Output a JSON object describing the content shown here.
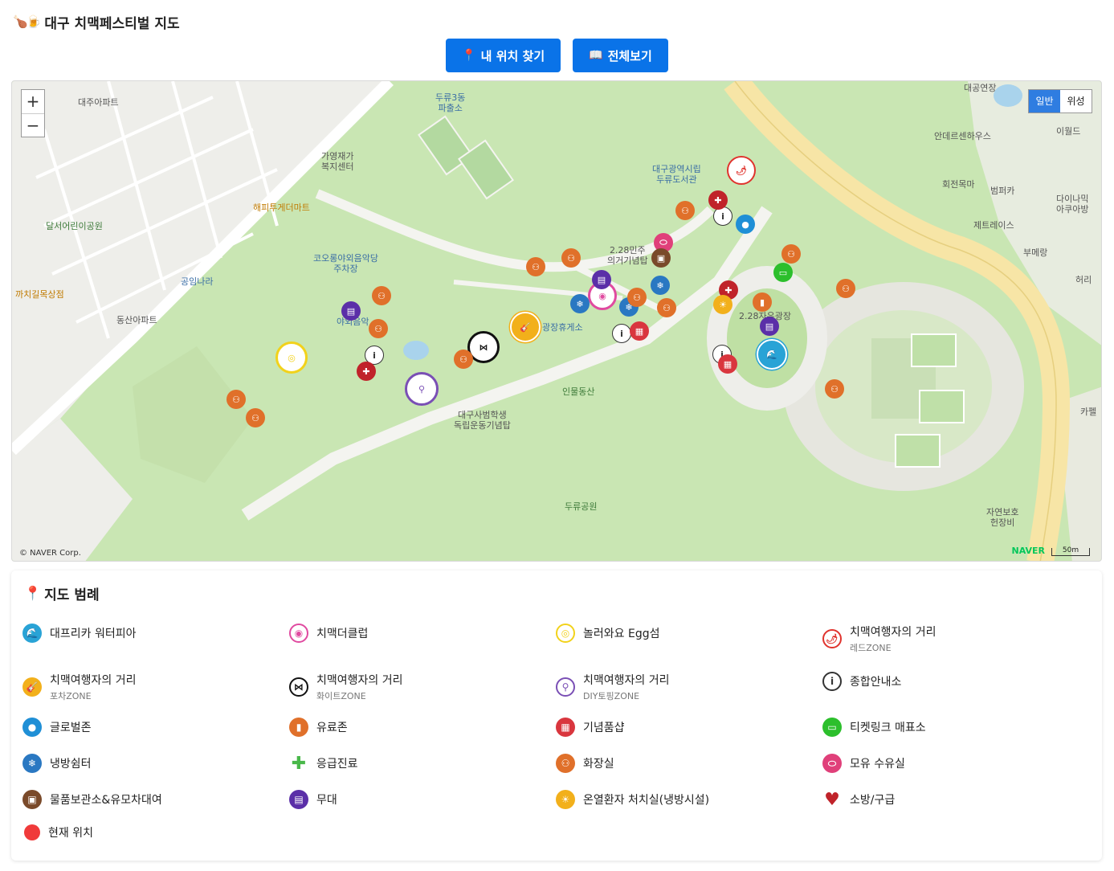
{
  "header": {
    "logo": "🍗🍺",
    "title": "대구 치맥페스티벌 지도"
  },
  "buttons": {
    "locate": {
      "icon": "📍",
      "label": "내 위치 찾기"
    },
    "overview": {
      "icon": "📖",
      "label": "전체보기"
    }
  },
  "map": {
    "zoom_in": "+",
    "zoom_out": "−",
    "map_types": [
      "일반",
      "위성"
    ],
    "selected_map_type": "일반",
    "copyright": "© NAVER Corp.",
    "brand": "NAVER",
    "scale": "50m",
    "place_labels": {
      "daeju_apt": "대주아파트",
      "duryu3dong": "두류3동\n파출소",
      "daegong": "대공연장",
      "iworld": "이월드",
      "andersen": "안데르센하우스",
      "hoejeon": "회전목마",
      "bumper": "범퍼카",
      "daina": "다이나믹\n아쿠아방",
      "jet": "제트레이스",
      "boomerang": "부메랑",
      "heuri": "허리",
      "gayeong": "가영재가\n복지센터",
      "daegu_lib": "대구광역시립\n두류도서관",
      "happy_mart": "해피투게더마트",
      "dalseo_park": "달서어린이공원",
      "korong": "코오롱야외음악당\n주차장",
      "gongim": "공임나라",
      "ggachi": "까치길목상점",
      "dongsan": "동산아파트",
      "dong228": "2.28민주\n의거기념탑",
      "square": "2.28자유광장",
      "rest": "광장휴게소",
      "inmul": "인물동산",
      "teachers": "대구사범학생\n독립운동기념탑",
      "duryu_park": "두류공원",
      "nature": "자연보호\n헌장비",
      "cafe": "카펠",
      "outdoor": "야외음악"
    }
  },
  "legend": {
    "icon": "📍",
    "title": "지도 범례",
    "items": [
      {
        "name": "대프리카 워터피아",
        "sub": "",
        "color": "#29a3d6",
        "icon": "water"
      },
      {
        "name": "치맥더클럽",
        "sub": "",
        "color": "#e04aa0",
        "icon": "club"
      },
      {
        "name": "놀러와요 Egg섬",
        "sub": "",
        "color": "#f2d21b",
        "icon": "egg"
      },
      {
        "name": "치맥여행자의 거리",
        "sub": "레드ZONE",
        "color": "#e0332d",
        "icon": "chili"
      },
      {
        "name": "치맥여행자의 거리",
        "sub": "포차ZONE",
        "color": "#f2b01b",
        "icon": "guitar"
      },
      {
        "name": "치맥여행자의 거리",
        "sub": "화이트ZONE",
        "color": "#111111",
        "icon": "bowtie"
      },
      {
        "name": "치맥여행자의 거리",
        "sub": "DIY토핑ZONE",
        "color": "#7a4fb5",
        "icon": "whisk"
      },
      {
        "name": "종합안내소",
        "sub": "",
        "color": "#333333",
        "icon": "info"
      },
      {
        "name": "글로벌존",
        "sub": "",
        "color": "#1f8fd6",
        "icon": "globe"
      },
      {
        "name": "유료존",
        "sub": "",
        "color": "#e0702a",
        "icon": "paid"
      },
      {
        "name": "기념품샵",
        "sub": "",
        "color": "#d9363e",
        "icon": "gift"
      },
      {
        "name": "티켓링크 매표소",
        "sub": "",
        "color": "#2cbf2c",
        "icon": "ticket"
      },
      {
        "name": "냉방쉼터",
        "sub": "",
        "color": "#2a78c2",
        "icon": "snow"
      },
      {
        "name": "응급진료",
        "sub": "",
        "color": "#49b84a",
        "icon": "cross"
      },
      {
        "name": "화장실",
        "sub": "",
        "color": "#e0702a",
        "icon": "toilet"
      },
      {
        "name": "모유 수유실",
        "sub": "",
        "color": "#e0407a",
        "icon": "bottle"
      },
      {
        "name": "물품보관소&유모차대여",
        "sub": "",
        "color": "#7a4a2a",
        "icon": "locker"
      },
      {
        "name": "무대",
        "sub": "",
        "color": "#5b2fa8",
        "icon": "stage"
      },
      {
        "name": "온열환자 처치실(냉방시설)",
        "sub": "",
        "color": "#f2b01b",
        "icon": "sun"
      },
      {
        "name": "소방/구급",
        "sub": "",
        "color": "#c0232a",
        "icon": "heart"
      },
      {
        "name": "현재 위치",
        "sub": "",
        "color": "#f03a3a",
        "icon": "dot"
      }
    ]
  }
}
